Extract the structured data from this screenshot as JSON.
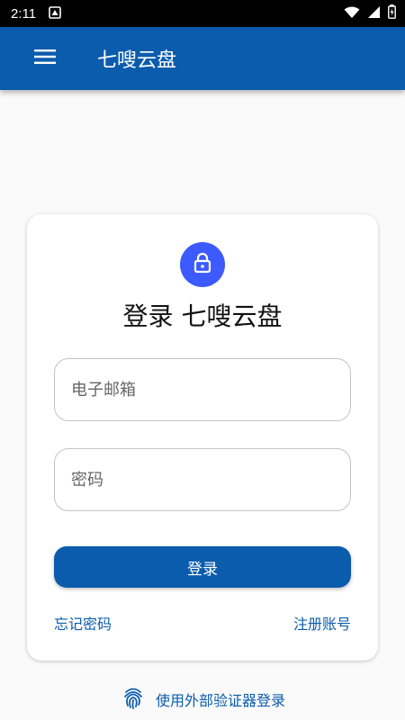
{
  "status_bar": {
    "time": "2:11"
  },
  "app_bar": {
    "title": "七嗖云盘"
  },
  "login_card": {
    "title": "登录 七嗖云盘",
    "email_placeholder": "电子邮箱",
    "password_placeholder": "密码",
    "login_button": "登录",
    "forgot_password": "忘记密码",
    "register": "注册账号"
  },
  "external_login": {
    "label": "使用外部验证器登录"
  },
  "colors": {
    "primary": "#0b5cad",
    "lock_badge": "#3d5afe",
    "background": "#fafafa"
  },
  "icons": {
    "menu": "menu-icon",
    "lock": "lock-icon",
    "fingerprint": "fingerprint-icon"
  }
}
